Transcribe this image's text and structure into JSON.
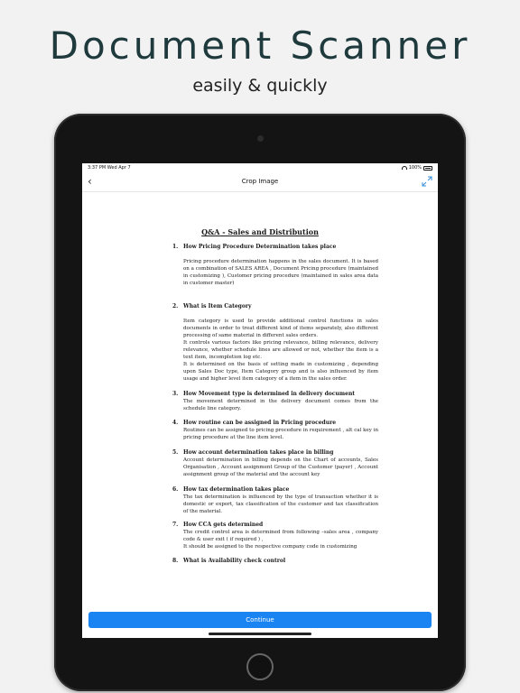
{
  "promo": {
    "headline": "Document Scanner",
    "subheadline": "easily & quickly"
  },
  "status_bar": {
    "time": "3:37 PM  Wed Apr 7",
    "battery": "100%"
  },
  "navbar": {
    "title": "Crop Image",
    "back_icon": "chevron-left-icon",
    "expand_icon": "expand-arrows-icon"
  },
  "document": {
    "title": "Q&A - Sales and Distribution",
    "questions": [
      {
        "number": "1.",
        "heading": "How Pricing Procedure Determination takes place",
        "body": [
          "Pricing procedure determination happens in the sales document. It is based on a combination of SALES AREA , Document Pricing procedure (maintained in customizing ), Customer pricing procedure (maintained in sales area data in customer master)"
        ]
      },
      {
        "number": "2.",
        "heading": "What is Item Category",
        "body": [
          "Item category is used to provide additional control functions in sales documents in order to treat different kind of items separately, also different processing of same material in different sales orders.",
          "It controls various factors like pricing relevance, billing relevance, delivery relevance, whether schedule lines are allowed or not, whether the item is a text item, incompletion log etc.",
          "It is determined on the basis of setting made in customizing , depending upon Sales Doc type, Item Category group and is also influenced by item usage and higher level item category of a item in the sales order."
        ]
      },
      {
        "number": "3.",
        "heading": "How Movement type is determined in delivery document",
        "body": [
          "The movement determined in the delivery document comes from the schedule line category."
        ]
      },
      {
        "number": "4.",
        "heading": "How routine can be assigned in Pricing procedure",
        "body": [
          "Routines can be assigned to pricing procedure in requirement , alt cal key in pricing procedure at the line item level."
        ]
      },
      {
        "number": "5.",
        "heading": "How account determination takes place in billing",
        "body": [
          "Account determination in billing depends on the Chart of accounts, Sales Organisation , Account assignment Group of the Customer (payer) , Account assignment group of the material and the account key"
        ]
      },
      {
        "number": "6.",
        "heading": "How tax determination takes place",
        "body": [
          "The tax determination is influenced by the type of transaction whether it is domestic or export, tax classification of the customer and tax classification of the material."
        ]
      },
      {
        "number": "7.",
        "heading": "How CCA gets determined",
        "body": [
          "The credit control area is determined from following –sales area , company code & user exit ( if required ) ,",
          "It should be assigned to the respective company code in customizing"
        ]
      },
      {
        "number": "8.",
        "heading": "What is Availability check control",
        "body": []
      }
    ]
  },
  "actions": {
    "continue_label": "Continue"
  }
}
